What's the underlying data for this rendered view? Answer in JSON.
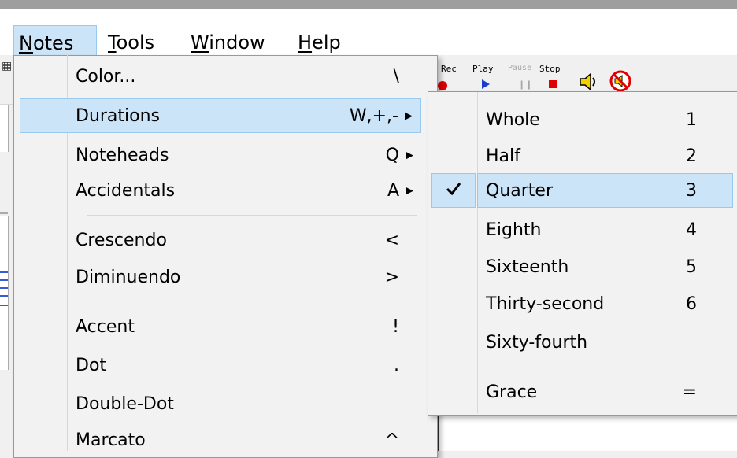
{
  "menubar": {
    "items": [
      {
        "label": "Notes",
        "accel": "N",
        "rest": "otes"
      },
      {
        "label": "Tools",
        "accel": "T",
        "rest": "ools"
      },
      {
        "label": "Window",
        "accel": "W",
        "rest": "indow"
      },
      {
        "label": "Help",
        "accel": "H",
        "rest": "elp"
      }
    ]
  },
  "toolbar": {
    "rec_label": "Rec",
    "play_label": "Play",
    "pause_label": "Pause",
    "stop_label": "Stop",
    "icons": [
      "record-icon",
      "play-icon",
      "pause-icon",
      "stop-icon",
      "speaker-icon",
      "mute-icon"
    ]
  },
  "notes_menu": {
    "items": [
      {
        "label": "Color...",
        "shortcut": "\\"
      },
      {
        "label": "Durations",
        "shortcut": "W,+,-",
        "submenu": true
      },
      {
        "label": "Noteheads",
        "shortcut": "Q",
        "submenu": true
      },
      {
        "label": "Accidentals",
        "shortcut": "A",
        "submenu": true
      },
      {
        "label": "Crescendo",
        "shortcut": "<"
      },
      {
        "label": "Diminuendo",
        "shortcut": ">"
      },
      {
        "label": "Accent",
        "shortcut": "!"
      },
      {
        "label": "Dot",
        "shortcut": "."
      },
      {
        "label": "Double-Dot",
        "shortcut": ""
      },
      {
        "label": "Marcato",
        "shortcut": "^"
      }
    ]
  },
  "durations_menu": {
    "items": [
      {
        "label": "Whole",
        "shortcut": "1"
      },
      {
        "label": "Half",
        "shortcut": "2"
      },
      {
        "label": "Quarter",
        "shortcut": "3",
        "checked": true
      },
      {
        "label": "Eighth",
        "shortcut": "4"
      },
      {
        "label": "Sixteenth",
        "shortcut": "5"
      },
      {
        "label": "Thirty-second",
        "shortcut": "6"
      },
      {
        "label": "Sixty-fourth",
        "shortcut": ""
      },
      {
        "label": "Grace",
        "shortcut": "="
      }
    ]
  },
  "colors": {
    "highlight": "#cce4f7",
    "highlight_border": "#99c9ef",
    "menu_bg": "#f2f2f2"
  }
}
